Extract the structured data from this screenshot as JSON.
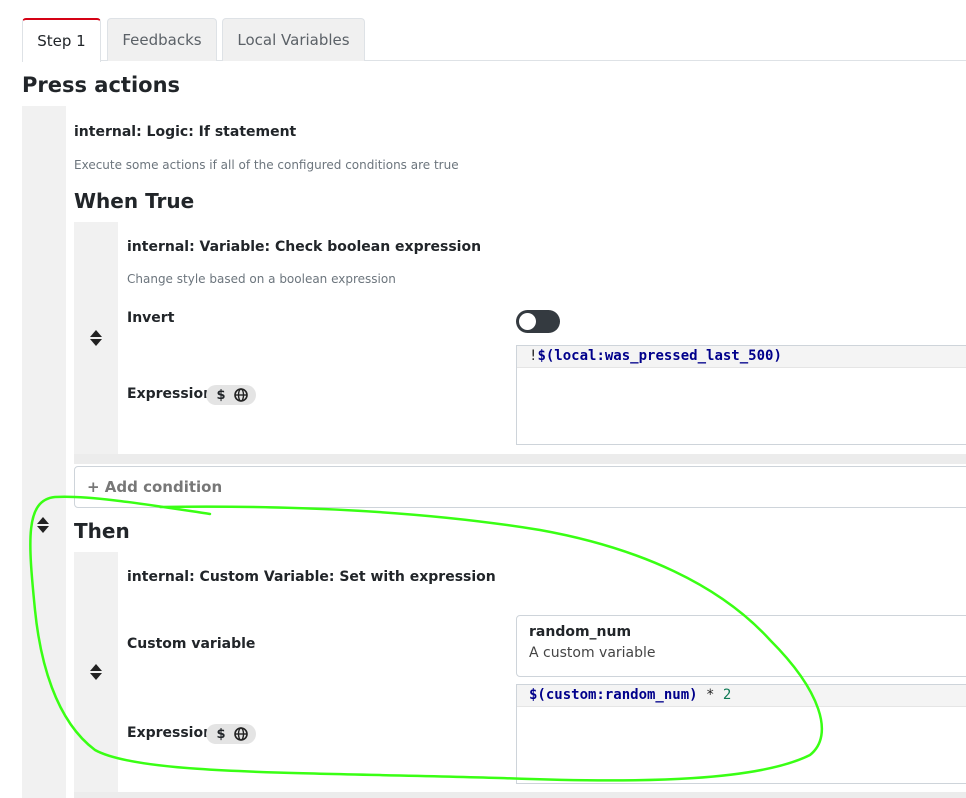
{
  "tabs": [
    {
      "label": "Step 1",
      "active": true
    },
    {
      "label": "Feedbacks",
      "active": false
    },
    {
      "label": "Local Variables",
      "active": false
    }
  ],
  "section_title": "Press actions",
  "action": {
    "title": "internal: Logic: If statement",
    "description": "Execute some actions if all of the configured conditions are true"
  },
  "when_true": {
    "heading": "When True",
    "condition": {
      "title": "internal: Variable: Check boolean expression",
      "description": "Change style based on a boolean expression",
      "invert_label": "Invert",
      "invert_value": false,
      "expression_label": "Expression",
      "expression_tokens": [
        {
          "text": "!",
          "kind": "op"
        },
        {
          "text": "$(local:was_pressed_last_500)",
          "kind": "var"
        }
      ]
    },
    "add_condition_label": "+ Add condition"
  },
  "then": {
    "heading": "Then",
    "action": {
      "title": "internal: Custom Variable: Set with expression",
      "custom_variable_label": "Custom variable",
      "custom_variable_value": "random_num",
      "custom_variable_description": "A custom variable",
      "expression_label": "Expression",
      "expression_tokens": [
        {
          "text": "$(custom:random_num)",
          "kind": "var"
        },
        {
          "text": " * ",
          "kind": "op"
        },
        {
          "text": "2",
          "kind": "num"
        }
      ]
    }
  },
  "pill": {
    "dollar": "$",
    "icons": [
      "dollar-icon",
      "globe-icon"
    ]
  },
  "colors": {
    "accent_tab": "#d50215",
    "toggle_off": "#343a40",
    "annotation": "#39ff14"
  }
}
